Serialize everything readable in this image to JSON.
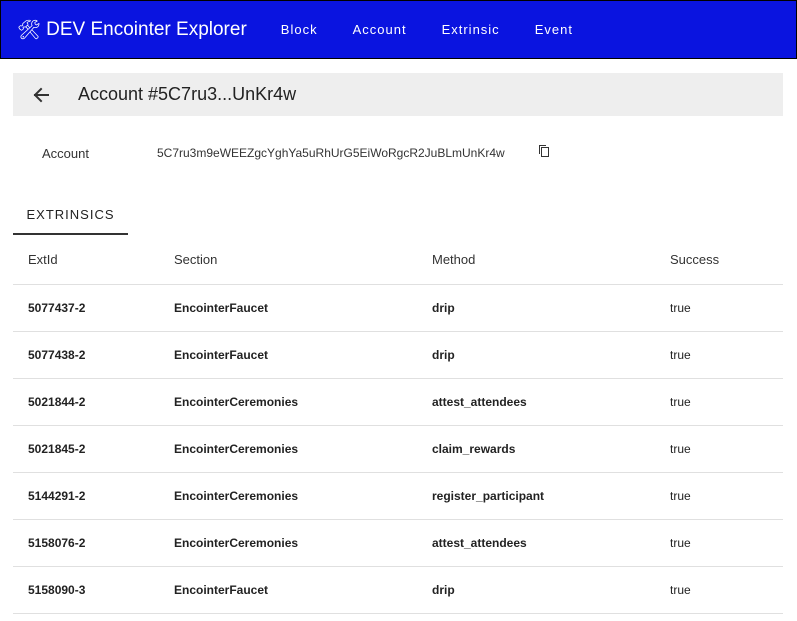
{
  "app": {
    "title": "DEV Encointer Explorer",
    "icon": "tools-icon"
  },
  "nav": [
    {
      "label": "Block"
    },
    {
      "label": "Account"
    },
    {
      "label": "Extrinsic"
    },
    {
      "label": "Event"
    }
  ],
  "page": {
    "title": "Account #5C7ru3...UnKr4w"
  },
  "account": {
    "label": "Account",
    "value": "5C7ru3m9eWEEZgcYghYa5uRhUrG5EiWoRgcR2JuBLmUnKr4w"
  },
  "tabs": [
    {
      "label": "EXTRINSICS",
      "active": true
    }
  ],
  "table": {
    "headers": [
      "ExtId",
      "Section",
      "Method",
      "Success"
    ],
    "rows": [
      [
        "5077437-2",
        "EncointerFaucet",
        "drip",
        "true"
      ],
      [
        "5077438-2",
        "EncointerFaucet",
        "drip",
        "true"
      ],
      [
        "5021844-2",
        "EncointerCeremonies",
        "attest_attendees",
        "true"
      ],
      [
        "5021845-2",
        "EncointerCeremonies",
        "claim_rewards",
        "true"
      ],
      [
        "5144291-2",
        "EncointerCeremonies",
        "register_participant",
        "true"
      ],
      [
        "5158076-2",
        "EncointerCeremonies",
        "attest_attendees",
        "true"
      ],
      [
        "5158090-3",
        "EncointerFaucet",
        "drip",
        "true"
      ]
    ]
  },
  "colors": {
    "topbar": "#0a14e0",
    "header_bg": "#eeeeee"
  }
}
